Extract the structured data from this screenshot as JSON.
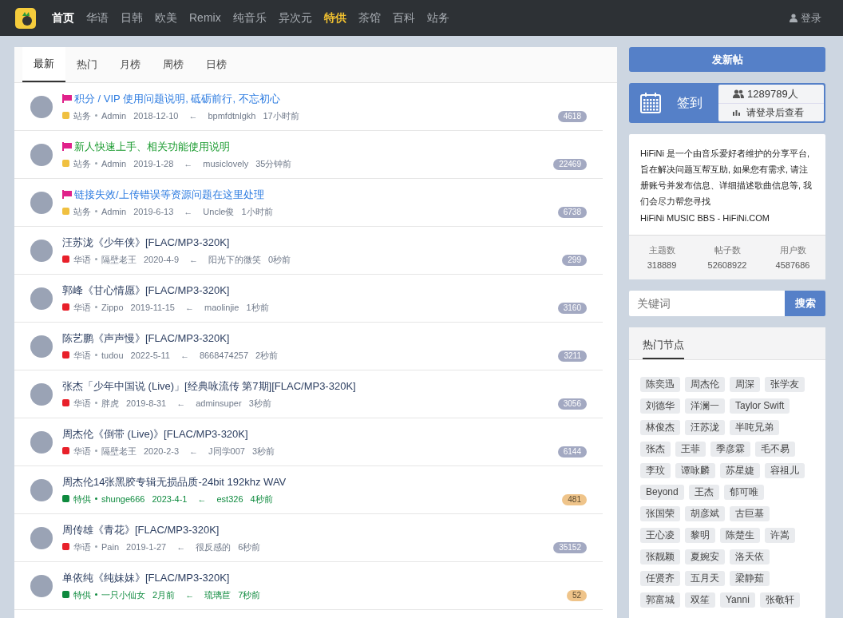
{
  "nav": {
    "items": [
      {
        "label": "首页",
        "selected": true,
        "kind": "normal"
      },
      {
        "label": "华语",
        "selected": false,
        "kind": "normal"
      },
      {
        "label": "日韩",
        "selected": false,
        "kind": "normal"
      },
      {
        "label": "欧美",
        "selected": false,
        "kind": "normal"
      },
      {
        "label": "Remix",
        "selected": false,
        "kind": "normal"
      },
      {
        "label": "纯音乐",
        "selected": false,
        "kind": "normal"
      },
      {
        "label": "异次元",
        "selected": false,
        "kind": "normal"
      },
      {
        "label": "特供",
        "selected": false,
        "kind": "special"
      },
      {
        "label": "茶馆",
        "selected": false,
        "kind": "normal"
      },
      {
        "label": "百科",
        "selected": false,
        "kind": "normal"
      },
      {
        "label": "站务",
        "selected": false,
        "kind": "normal"
      }
    ],
    "login": "登录"
  },
  "tabs": [
    {
      "label": "最新",
      "selected": true
    },
    {
      "label": "热门",
      "selected": false
    },
    {
      "label": "月榜",
      "selected": false
    },
    {
      "label": "周榜",
      "selected": false
    },
    {
      "label": "日榜",
      "selected": false
    }
  ],
  "threads": [
    {
      "pinned": true,
      "color": "#2f7de1",
      "title": "积分 / VIP 使用问题说明, 砥砺前行, 不忘初心",
      "category": {
        "name": "站务",
        "color": "#f0c040"
      },
      "author": "Admin",
      "date": "2018-12-10",
      "arrow": "←",
      "last_user": "bpmfdtnlgkh",
      "last_time": "17小时前",
      "replies": "4618",
      "featured": false
    },
    {
      "pinned": true,
      "color": "#1a9b2f",
      "title": "新人快速上手、相关功能使用说明",
      "category": {
        "name": "站务",
        "color": "#f0c040"
      },
      "author": "Admin",
      "date": "2019-1-28",
      "arrow": "←",
      "last_user": "musiclovely",
      "last_time": "35分钟前",
      "replies": "22469",
      "featured": false
    },
    {
      "pinned": true,
      "color": "#2f7de1",
      "title": "链接失效/上传错误等资源问题在这里处理",
      "category": {
        "name": "站务",
        "color": "#f0c040"
      },
      "author": "Admin",
      "date": "2019-6-13",
      "arrow": "←",
      "last_user": "Uncle俊",
      "last_time": "1小时前",
      "replies": "6738",
      "featured": false
    },
    {
      "pinned": false,
      "color": "#2c3e60",
      "title": "汪苏泷《少年侠》[FLAC/MP3-320K]",
      "category": {
        "name": "华语",
        "color": "#e8202a"
      },
      "author": "隔壁老王",
      "date": "2020-4-9",
      "arrow": "←",
      "last_user": "阳光下的微笑",
      "last_time": "0秒前",
      "replies": "299",
      "featured": false
    },
    {
      "pinned": false,
      "color": "#2c3e60",
      "title": "郭峰《甘心情愿》[FLAC/MP3-320K]",
      "category": {
        "name": "华语",
        "color": "#e8202a"
      },
      "author": "Zippo",
      "date": "2019-11-15",
      "arrow": "←",
      "last_user": "maolinjie",
      "last_time": "1秒前",
      "replies": "3160",
      "featured": false
    },
    {
      "pinned": false,
      "color": "#2c3e60",
      "title": "陈艺鹏《声声慢》[FLAC/MP3-320K]",
      "category": {
        "name": "华语",
        "color": "#e8202a"
      },
      "author": "tudou",
      "date": "2022-5-11",
      "arrow": "←",
      "last_user": "8668474257",
      "last_time": "2秒前",
      "replies": "3211",
      "featured": false
    },
    {
      "pinned": false,
      "color": "#2c3e60",
      "title": "张杰「少年中国说 (Live)」[经典咏流传 第7期][FLAC/MP3-320K]",
      "category": {
        "name": "华语",
        "color": "#e8202a"
      },
      "author": "胖虎",
      "date": "2019-8-31",
      "arrow": "←",
      "last_user": "adminsuper",
      "last_time": "3秒前",
      "replies": "3056",
      "featured": false
    },
    {
      "pinned": false,
      "color": "#2c3e60",
      "title": "周杰伦《倒带 (Live)》[FLAC/MP3-320K]",
      "category": {
        "name": "华语",
        "color": "#e8202a"
      },
      "author": "隔壁老王",
      "date": "2020-2-3",
      "arrow": "←",
      "last_user": "J同学007",
      "last_time": "3秒前",
      "replies": "6144",
      "featured": false
    },
    {
      "pinned": false,
      "color": "#2c3e60",
      "title": "周杰伦14张黑胶专辑无损品质-24bit 192khz WAV",
      "category": {
        "name": "特供",
        "color": "#0e8a3e"
      },
      "author": "shunge666",
      "date": "2023-4-1",
      "arrow": "←",
      "last_user": "est326",
      "last_time": "4秒前",
      "replies": "481",
      "featured": true
    },
    {
      "pinned": false,
      "color": "#2c3e60",
      "title": "周传雄《青花》[FLAC/MP3-320K]",
      "category": {
        "name": "华语",
        "color": "#e8202a"
      },
      "author": "Pain",
      "date": "2019-1-27",
      "arrow": "←",
      "last_user": "很反感的",
      "last_time": "6秒前",
      "replies": "35152",
      "featured": false
    },
    {
      "pinned": false,
      "color": "#2c3e60",
      "title": "单依纯《纯妹妹》[FLAC/MP3-320K]",
      "category": {
        "name": "特供",
        "color": "#0e8a3e"
      },
      "author": "一只小仙女",
      "date": "2月前",
      "arrow": "←",
      "last_user": "琉璃苣",
      "last_time": "7秒前",
      "replies": "52",
      "featured": true
    }
  ],
  "sidebar": {
    "new_post": "发新帖",
    "checkin": {
      "label": "签到",
      "users": "1289789人",
      "rank": "请登录后查看"
    },
    "about": [
      "HiFiNi 是一个由音乐爱好者维护的分享平台, 旨在解决问题互帮互助, 如果您有需求, 请注册账号并发布信息、详细描述歌曲信息等, 我们会尽力帮您寻找",
      "HiFiNi MUSIC BBS - HiFiNi.COM"
    ],
    "stats": [
      {
        "label": "主题数",
        "value": "318889"
      },
      {
        "label": "帖子数",
        "value": "52608922"
      },
      {
        "label": "用户数",
        "value": "4587686"
      }
    ],
    "search": {
      "placeholder": "关键词",
      "button": "搜索"
    },
    "hot": {
      "title": "热门节点",
      "tags": [
        "陈奕迅",
        "周杰伦",
        "周深",
        "张学友",
        "刘德华",
        "洋澜一",
        "Taylor Swift",
        "林俊杰",
        "汪苏泷",
        "半吨兄弟",
        "张杰",
        "王菲",
        "季彦霖",
        "毛不易",
        "李玟",
        "谭咏麟",
        "苏星婕",
        "容祖儿",
        "Beyond",
        "王杰",
        "郁可唯",
        "张国荣",
        "胡彦斌",
        "古巨基",
        "王心凌",
        "黎明",
        "陈楚生",
        "许嵩",
        "张靓颖",
        "夏婉安",
        "洛天依",
        "任贤齐",
        "五月天",
        "梁静茹",
        "郭富城",
        "双笙",
        "Yanni",
        "张敬轩"
      ]
    }
  }
}
